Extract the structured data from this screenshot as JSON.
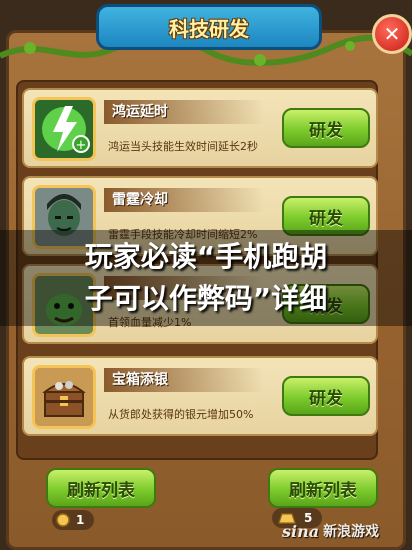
{
  "title": "科技研发",
  "techs": [
    {
      "name": "鸿运延时",
      "description": "鸿运当头技能生效时间延长2秒",
      "research_label": "研发",
      "icon": "lightning-hourglass-icon"
    },
    {
      "name": "雷霆冷却",
      "description": "雷霆手段技能冷却时间缩短2%",
      "research_label": "研发",
      "icon": "warrior-portrait-icon"
    },
    {
      "name": "",
      "description": "首领血量减少1%",
      "research_label": "研发",
      "icon": "goblin-portrait-icon"
    },
    {
      "name": "宝箱添银",
      "description": "从货郎处获得的银元增加50%",
      "research_label": "研发",
      "icon": "treasure-chest-icon"
    }
  ],
  "refresh_buttons": [
    {
      "label": "刷新列表",
      "cost": "1",
      "currency_icon": "coin-icon"
    },
    {
      "label": "刷新列表",
      "cost": "5",
      "currency_icon": "gold-bar-icon"
    }
  ],
  "overlay": {
    "line1": "玩家必读“手机跑胡",
    "line2": "子可以作弊码”详细"
  },
  "watermark": {
    "brand": "sina",
    "text": "新浪游戏"
  },
  "colors": {
    "research_button": "#7ccb2c",
    "title_banner": "#1d86c1",
    "close_button": "#c81e14",
    "panel_wood": "#96632f"
  }
}
